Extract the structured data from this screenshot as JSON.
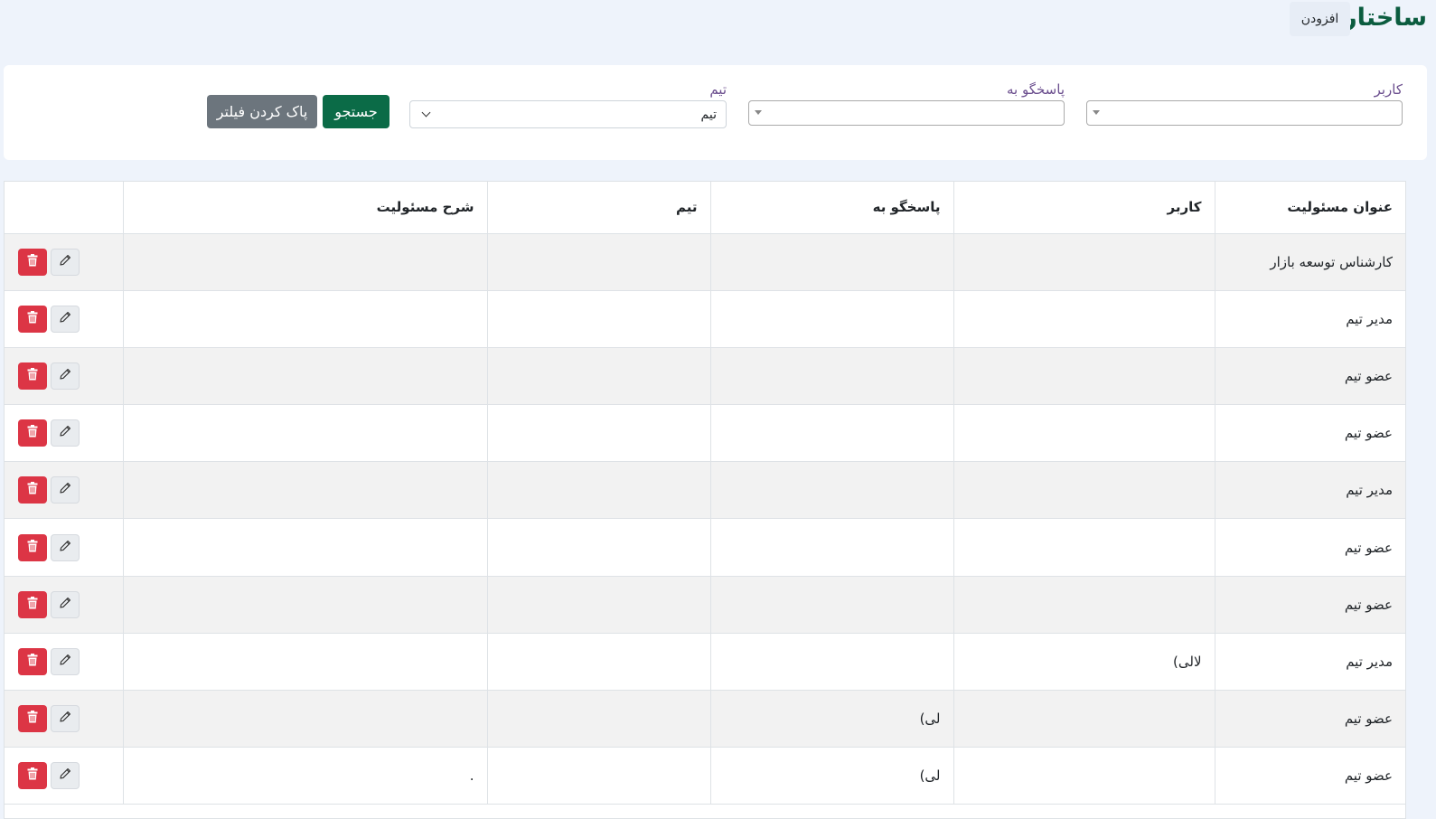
{
  "header": {
    "title": "ساختار",
    "add_label": "افزودن"
  },
  "filters": {
    "user_label": "کاربر",
    "respond_label": "پاسخگو به",
    "team_label": "تیم",
    "team_value": "تیم",
    "search_label": "جستجو",
    "clear_label": "پاک کردن فیلتر"
  },
  "table": {
    "headers": [
      "عنوان مسئولیت",
      "کاربر",
      "پاسخگو به",
      "تیم",
      "شرح مسئولیت"
    ],
    "rows": [
      {
        "title": "کارشناس توسعه بازار",
        "user": "",
        "respond": "",
        "team": "",
        "desc": ""
      },
      {
        "title": "مدیر تیم",
        "user": "",
        "respond": "",
        "team": "",
        "desc": ""
      },
      {
        "title": "عضو تیم",
        "user": "",
        "respond": "",
        "team": "",
        "desc": ""
      },
      {
        "title": "عضو تیم",
        "user": "",
        "respond": "",
        "team": "",
        "desc": ""
      },
      {
        "title": "مدیر تیم",
        "user": "",
        "respond": "",
        "team": "",
        "desc": ""
      },
      {
        "title": "عضو تیم",
        "user": "",
        "respond": "",
        "team": "",
        "desc": ""
      },
      {
        "title": "عضو تیم",
        "user": "",
        "respond": "",
        "team": "",
        "desc": ""
      },
      {
        "title": "مدیر تیم",
        "user": "لالی)",
        "respond": "",
        "team": "",
        "desc": ""
      },
      {
        "title": "عضو تیم",
        "user": "",
        "respond": "لی)",
        "team": "",
        "desc": ""
      },
      {
        "title": "عضو تیم",
        "user": "",
        "respond": "لی)",
        "team": "",
        "desc": "."
      }
    ]
  },
  "colors": {
    "brand": "#0b5c3f",
    "search": "#0b6b47",
    "clear": "#6c757d",
    "delete": "#dc3545",
    "label": "#6b4e8e"
  },
  "icons": {
    "edit": "pencil-icon",
    "delete": "trash-icon"
  }
}
